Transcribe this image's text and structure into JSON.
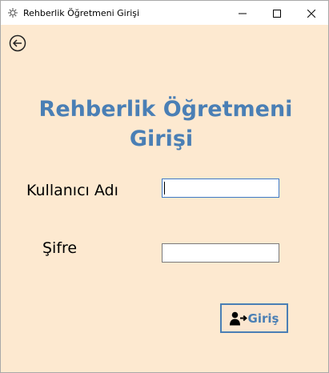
{
  "window": {
    "title": "Rehberlik Öğretmeni Girişi",
    "icons": {
      "app": "gear-flower-icon",
      "minimize": "minimize-icon",
      "maximize": "maximize-icon",
      "close": "close-icon"
    }
  },
  "nav": {
    "back_icon": "arrow-left-circle-icon"
  },
  "heading": {
    "line1": "Rehberlik Öğretmeni",
    "line2": "Girişi",
    "color": "#4a7fb5"
  },
  "form": {
    "username_label": "Kullanıcı Adı",
    "username_value": "",
    "password_label": "Şifre",
    "password_value": ""
  },
  "login_button": {
    "label": "Giriş",
    "icon": "user-sign-in-icon"
  },
  "colors": {
    "background": "#fde9d0",
    "accent": "#4a7fb5",
    "titlebar": "#ffffff"
  }
}
